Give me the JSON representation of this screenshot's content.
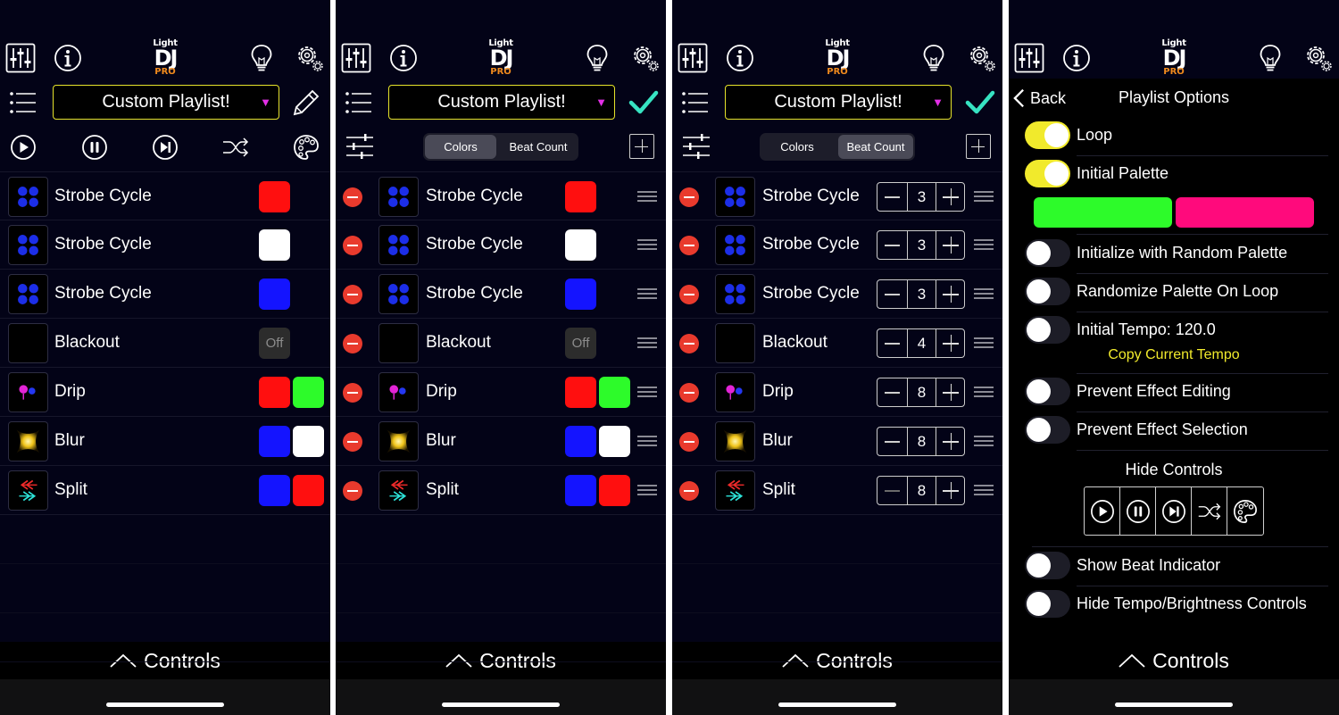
{
  "logo": {
    "line1": "Light",
    "line2": "DJ",
    "line3": "PRO"
  },
  "playlist_name": "Custom Playlist!",
  "controls_label": "Controls",
  "colors": {
    "red": "#ff0f0f",
    "white": "#ffffff",
    "blue": "#1414ff",
    "green": "#2dfb2a",
    "pink": "#ff0a7c",
    "accent": "#f1ea2c",
    "check": "#37e3c2"
  },
  "effects": [
    {
      "name": "Strobe Cycle",
      "swatches": [
        "#ff0f0f"
      ],
      "beats": "3"
    },
    {
      "name": "Strobe Cycle",
      "swatches": [
        "#ffffff"
      ],
      "beats": "3"
    },
    {
      "name": "Strobe Cycle",
      "swatches": [
        "#1414ff"
      ],
      "beats": "3"
    },
    {
      "name": "Blackout",
      "swatches": [],
      "off": "Off",
      "beats": "4"
    },
    {
      "name": "Drip",
      "swatches": [
        "#ff0f0f",
        "#2dfb2a"
      ],
      "beats": "8"
    },
    {
      "name": "Blur",
      "swatches": [
        "#1414ff",
        "#ffffff"
      ],
      "beats": "8"
    },
    {
      "name": "Split",
      "swatches": [
        "#1414ff",
        "#ff0f0f"
      ],
      "beats": "8"
    }
  ],
  "segment": {
    "colors": "Colors",
    "beat_count": "Beat Count"
  },
  "options": {
    "back": "Back",
    "title": "Playlist Options",
    "loop": "Loop",
    "initial_palette": "Initial Palette",
    "random_palette": "Initialize with Random Palette",
    "randomize_loop": "Randomize Palette On Loop",
    "initial_tempo": "Initial Tempo: 120.0",
    "copy_tempo": "Copy Current Tempo",
    "prevent_editing": "Prevent Effect Editing",
    "prevent_selection": "Prevent Effect Selection",
    "hide_controls": "Hide Controls",
    "show_beat": "Show Beat Indicator",
    "hide_tempo": "Hide Tempo/Brightness Controls"
  },
  "icons": [
    "mixer-icon",
    "info-icon",
    "bulb-icon",
    "gear-icon",
    "list-icon",
    "pencil-icon",
    "check-icon",
    "sliders-icon",
    "play-icon",
    "pause-icon",
    "next-icon",
    "shuffle-icon",
    "palette-icon",
    "plus-icon",
    "chevron-up-icon",
    "chevron-left-icon",
    "drag-handle-icon",
    "delete-icon"
  ]
}
